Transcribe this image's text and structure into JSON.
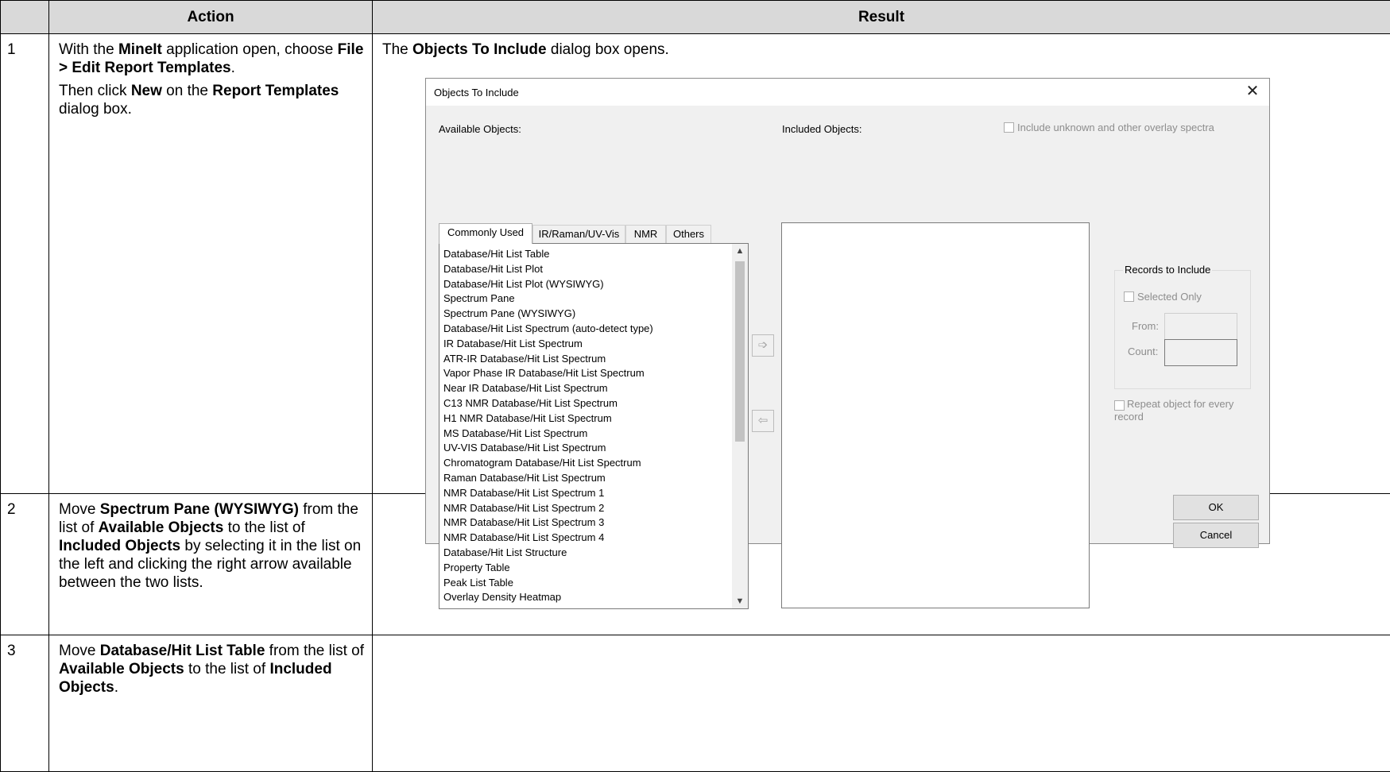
{
  "table": {
    "headers": [
      "Action",
      "Result"
    ],
    "rows": [
      {
        "num": "1",
        "action": {
          "p1": [
            "With the ",
            "MineIt",
            " application open, choose ",
            "File > Edit Report Templates",
            "."
          ],
          "p2": [
            "Then click ",
            "New",
            " on the ",
            "Report Templates",
            " dialog box."
          ]
        },
        "result": [
          "The ",
          "Objects To Include",
          " dialog box opens."
        ]
      },
      {
        "num": "2",
        "action": [
          "Move ",
          "Spectrum Pane (WYSIWYG)",
          " from the list of ",
          "Available Objects",
          " to the list of ",
          "Included Objects",
          " by selecting it in the list on the left and clicking the right arrow available between the two lists."
        ]
      },
      {
        "num": "3",
        "action": [
          "Move ",
          "Database/Hit List Table",
          " from the list of ",
          "Available Objects",
          " to the list of ",
          "Included Objects",
          "."
        ]
      }
    ]
  },
  "dialog": {
    "title": "Objects To Include",
    "close_icon": "close-icon",
    "available_label": "Available Objects:",
    "included_label": "Included Objects:",
    "include_unknown_label": "Include unknown and other overlay spectra",
    "tabs": [
      "Commonly Used",
      "IR/Raman/UV-Vis",
      "NMR",
      "Others"
    ],
    "active_tab": "Commonly Used",
    "available_items": [
      "Database/Hit List Table",
      "Database/Hit List Plot",
      "Database/Hit List Plot (WYSIWYG)",
      "Spectrum Pane",
      "Spectrum Pane (WYSIWYG)",
      "Database/Hit List Spectrum (auto-detect type)",
      "IR Database/Hit List Spectrum",
      "ATR-IR Database/Hit List Spectrum",
      "Vapor Phase IR Database/Hit List Spectrum",
      "Near IR Database/Hit List Spectrum",
      "C13 NMR Database/Hit List Spectrum",
      "H1 NMR Database/Hit List Spectrum",
      "MS Database/Hit List Spectrum",
      "UV-VIS Database/Hit List Spectrum",
      "Chromatogram Database/Hit List Spectrum",
      "Raman Database/Hit List Spectrum",
      "NMR Database/Hit List Spectrum 1",
      "NMR Database/Hit List Spectrum 2",
      "NMR Database/Hit List Spectrum 3",
      "NMR Database/Hit List Spectrum 4",
      "Database/Hit List Structure",
      "Property Table",
      "Peak List Table",
      "Overlay Density Heatmap"
    ],
    "add_arrow_icon": "right-arrow-icon",
    "remove_arrow_icon": "left-arrow-icon",
    "records_group_title": "Records to Include",
    "selected_only_label": "Selected Only",
    "from_label": "From:",
    "count_label": "Count:",
    "repeat_label": "Repeat object for every record",
    "ok_label": "OK",
    "cancel_label": "Cancel"
  }
}
